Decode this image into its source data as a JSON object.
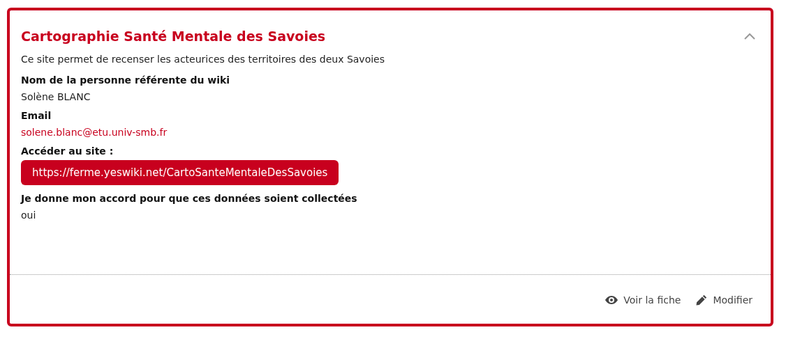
{
  "card": {
    "title": "Cartographie Santé Mentale des Savoies",
    "expanded": true,
    "description": "Ce site permet de recenser les acteurices des territoires des deux Savoies",
    "fields": [
      {
        "label": "Nom de la personne référente du wiki",
        "value": "Solène BLANC",
        "kind": "text"
      },
      {
        "label": "Email",
        "value": "solene.blanc@etu.univ-smb.fr",
        "kind": "email"
      },
      {
        "label": "Accéder au site :",
        "value": "https://ferme.yeswiki.net/CartoSanteMentaleDesSavoies",
        "kind": "button"
      },
      {
        "label": "Je donne mon accord pour que ces données soient collectées",
        "value": "oui",
        "kind": "text"
      }
    ],
    "actions": [
      {
        "label": "Voir la fiche",
        "kind": "view"
      },
      {
        "label": "Modifier",
        "kind": "edit"
      }
    ]
  }
}
